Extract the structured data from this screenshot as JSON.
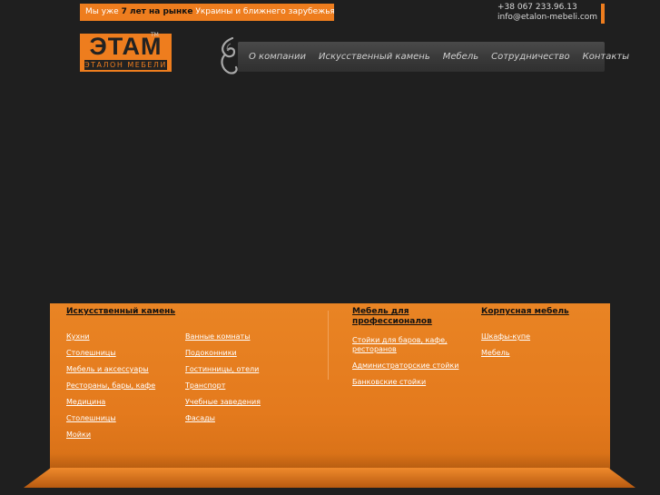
{
  "header": {
    "tagline_prefix": "Мы уже",
    "tagline_bold": "7 лет на рынке",
    "tagline_suffix": "Украины и ближнего зарубежья",
    "phone": "+38 067 233.96.13",
    "email": "info@etalon-mebeli.com"
  },
  "logo": {
    "main": "ЭТАМ",
    "sub": "ЭТАЛОН МЕБЕЛИ",
    "tm": "TM"
  },
  "nav": {
    "items": [
      "О компании",
      "Искусственный камень",
      "Мебель",
      "Сотрудничество",
      "Контакты"
    ]
  },
  "footer": {
    "stone": {
      "title": "Искусственный камень",
      "col1": [
        "Кухни",
        "Столешницы",
        "Мебель и аксессуары",
        "Рестораны, бары, кафе",
        "Медицина",
        "Столешницы",
        "Мойки"
      ],
      "col2": [
        "Ванные комнаты",
        "Подоконники",
        "Гостинницы, отели",
        "Транспорт",
        "Учебные заведения",
        "Фасады"
      ]
    },
    "pro": {
      "title": "Мебель для профессионалов",
      "items": [
        "Стойки для баров, кафе, ресторанов",
        "Администраторские стойки",
        "Банковские стойки"
      ]
    },
    "cabinet": {
      "title": "Корпусная мебель",
      "items": [
        "Шкафы-купе",
        "Мебель"
      ]
    }
  },
  "colors": {
    "accent": "#ee7d1e",
    "background": "#1f1f1f"
  },
  "icons": {
    "nav_swirl": "swirl-ornament-icon"
  }
}
